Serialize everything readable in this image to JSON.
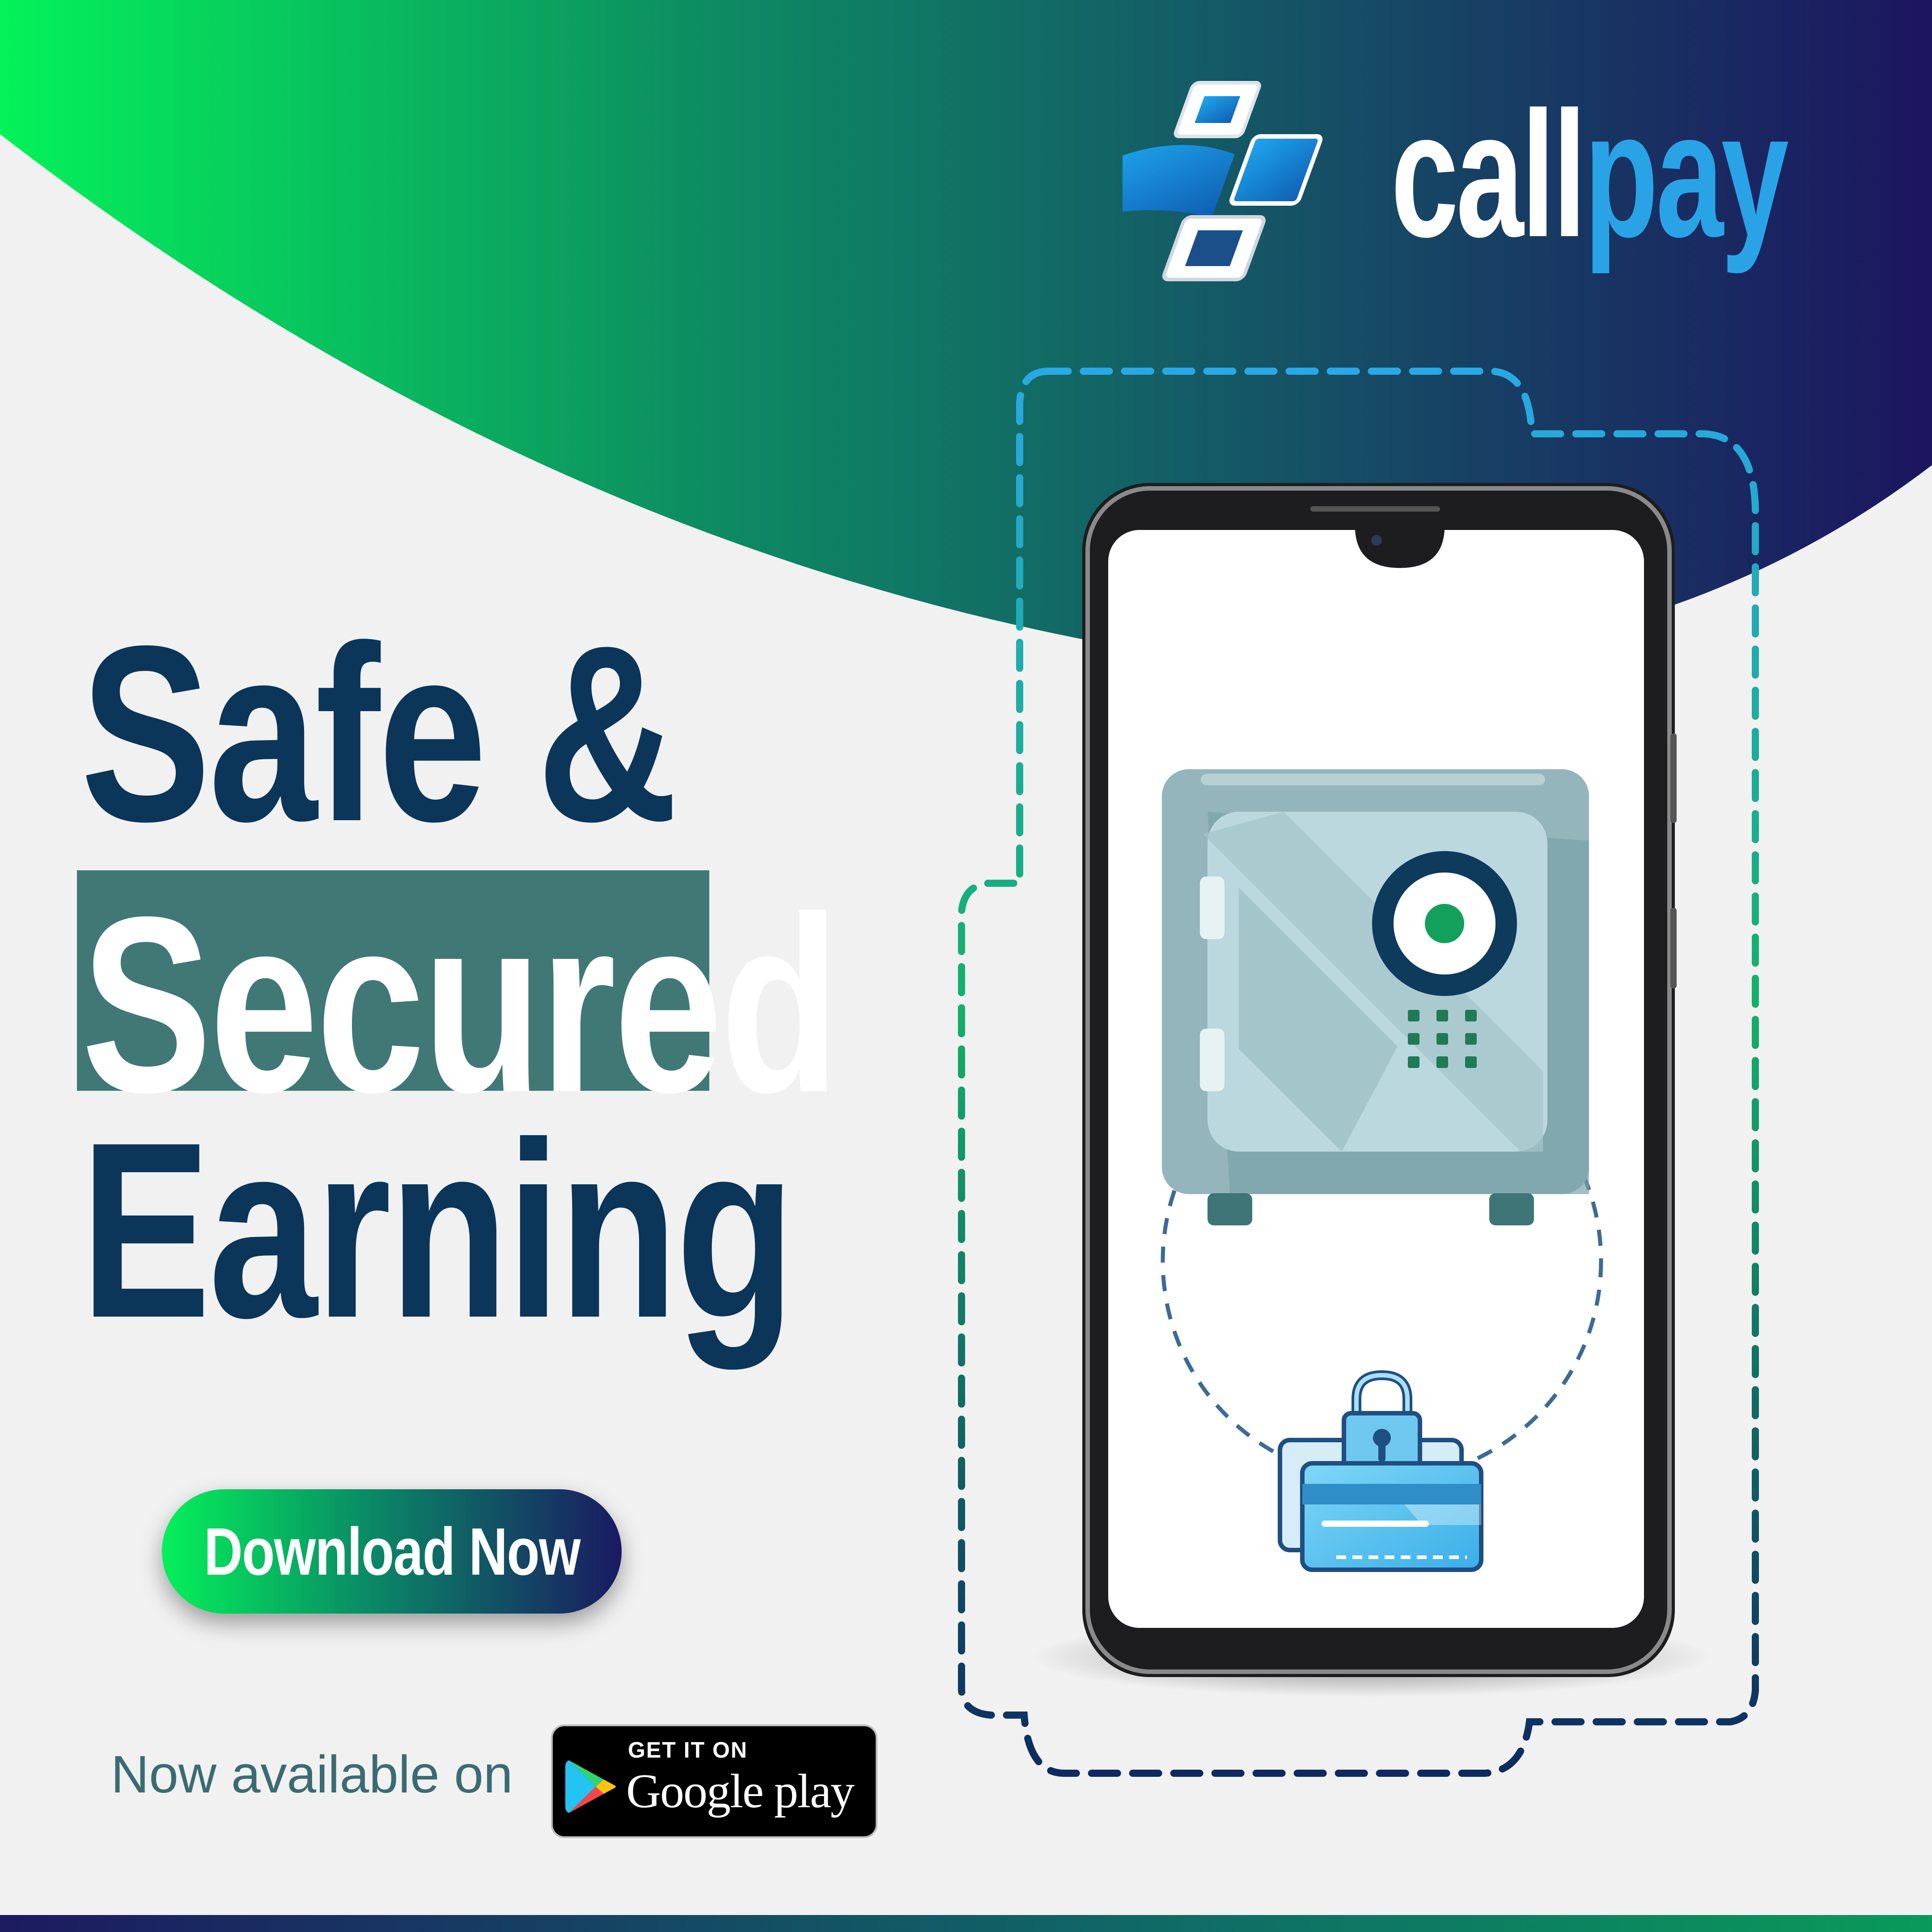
{
  "brand": {
    "part1": "call",
    "part2": "pay"
  },
  "headline": {
    "line1": "Safe &",
    "line2": "Secured",
    "line3": "Earning"
  },
  "cta": {
    "label": "Download Now"
  },
  "availability": {
    "text": "Now available on"
  },
  "store_badge": {
    "top_text": "GET IT ON",
    "main_text": "Google play",
    "icon": "google-play-icon"
  },
  "colors": {
    "navy": "#0b3559",
    "teal_box": "#407876",
    "green": "#05f05a",
    "indigo": "#1a1a62",
    "brand_blue": "#2aa3e6"
  },
  "illustration": {
    "phone_icon": "smartphone",
    "screen_icons": [
      "safe-vault-icon",
      "locked-credit-card-icon"
    ]
  }
}
